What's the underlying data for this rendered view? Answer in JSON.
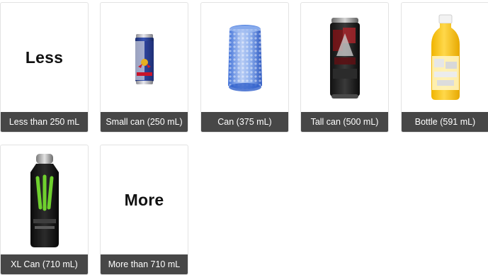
{
  "options": [
    {
      "id": "less",
      "label": "Less than 250 mL",
      "display_text": "Less",
      "icon": "text"
    },
    {
      "id": "small-can",
      "label": "Small can (250 mL)",
      "icon": "small-can-icon"
    },
    {
      "id": "can",
      "label": "Can (375 mL)",
      "icon": "can-icon"
    },
    {
      "id": "tall-can",
      "label": "Tall can (500 mL)",
      "icon": "tall-can-icon"
    },
    {
      "id": "bottle",
      "label": "Bottle (591 mL)",
      "icon": "bottle-icon"
    },
    {
      "id": "xl-can",
      "label": "XL Can (710 mL)",
      "icon": "xl-can-icon"
    },
    {
      "id": "more",
      "label": "More than 710 mL",
      "display_text": "More",
      "icon": "text"
    }
  ]
}
